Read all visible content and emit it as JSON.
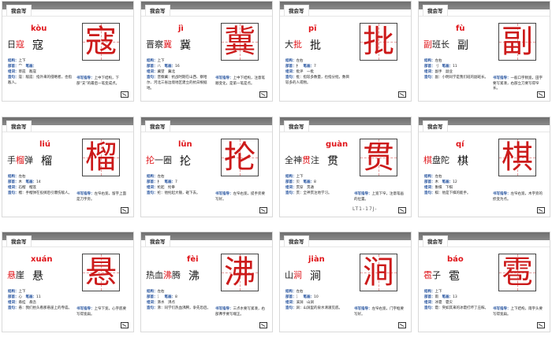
{
  "slides": [
    {
      "tab": "我会写",
      "pre": "日",
      "hl": "寇",
      "post": "",
      "pinyin": "kòu",
      "char": "寇",
      "structure": "上下",
      "radical": "宀",
      "strokes": "",
      "words": "草寇　敌寇",
      "note": "寇：敌寇：指外来的侵略者，也指敌人。",
      "guide": "上中下结构，下部“支”的最后一笔变成点。"
    },
    {
      "tab": "我会写",
      "pre": "晋察",
      "hl": "冀",
      "post": "",
      "pinyin": "jì",
      "char": "冀",
      "structure": "上下",
      "radical": "八",
      "strokes": "16",
      "words": "冀望　冀北",
      "note": "晋察冀：抗战时期在山西、察哈尔、河北三省边境地区建立的抗日根据地。",
      "guide": "上中下结构，注意笔顺变化，是第一笔是点。"
    },
    {
      "tab": "我会写",
      "pre": "大",
      "hl": "批",
      "post": "",
      "pinyin": "pī",
      "char": "批",
      "structure": "左右",
      "radical": "扌",
      "strokes": "7",
      "words": "批评　一批",
      "note": "批：指较多数量，也指分批，数目较多的人或物。",
      "guide": ""
    },
    {
      "tab": "我会写",
      "pre": "",
      "hl": "副",
      "post": "班长",
      "pinyin": "fù",
      "char": "副",
      "structure": "左右",
      "radical": "刂",
      "strokes": "11",
      "words": "副手　副业",
      "note": "副：小明同学是我们班的副班长。",
      "guide": "一般口字稍宽，田字要写紧凑，右部立刀要写得窄长。"
    },
    {
      "tab": "我会写",
      "pre": "手",
      "hl": "榴",
      "post": "弹",
      "pinyin": "liú",
      "char": "榴",
      "structure": "左右",
      "radical": "木",
      "strokes": "14",
      "words": "石榴　榴莲",
      "note": "榴：手榴弹在投掷后引爆伤敌人。",
      "guide": "左窄右宽，留字上面是刀字旁。"
    },
    {
      "tab": "我会写",
      "pre": "",
      "hl": "抡",
      "post": "一圈",
      "pinyin": "lūn",
      "char": "抡",
      "structure": "左右",
      "radical": "扌",
      "strokes": "7",
      "words": "抡起　抡拳",
      "note": "抡：他抡起大锤，砸下去。",
      "guide": "左窄右宽，提手旁要写好。"
    },
    {
      "tab": "我会写",
      "pre": "全神",
      "hl": "贯",
      "post": "注",
      "pinyin": "guàn",
      "char": "贯",
      "structure": "上下",
      "radical": "贝",
      "strokes": "8",
      "words": "贯穿　贯通",
      "note": "贯：全神贯注地学习。",
      "guide": "上宽下窄，注意笔画的位置。",
      "scribble": "LT1-17J-"
    },
    {
      "tab": "我会写",
      "pre": "",
      "hl": "棋",
      "post": "盘陀",
      "pinyin": "qí",
      "char": "棋",
      "structure": "左右",
      "radical": "木",
      "strokes": "12",
      "words": "象棋　下棋",
      "note": "棋：他是下棋的能手。",
      "guide": "左窄右宽，木字旁的捺变为点。"
    },
    {
      "tab": "我会写",
      "pre": "",
      "hl": "悬",
      "post": "崖",
      "pinyin": "xuán",
      "char": "悬",
      "structure": "上下",
      "radical": "心",
      "strokes": "11",
      "words": "悬挂　悬念",
      "note": "悬：我们抬头看那悬崖上的寺庙。",
      "guide": "上窄下宽，心字底要写得宽扁。"
    },
    {
      "tab": "我会写",
      "pre": "热血",
      "hl": "沸",
      "post": "腾",
      "pinyin": "fèi",
      "char": "沸",
      "structure": "左右",
      "radical": "氵",
      "strokes": "8",
      "words": "沸水　沸点",
      "note": "沸：同学们热血沸腾，争先恐后。",
      "guide": "三点水要写紧凑，右部弗字要写端正。"
    },
    {
      "tab": "我会写",
      "pre": "山",
      "hl": "涧",
      "post": "",
      "pinyin": "jiàn",
      "char": "涧",
      "structure": "左右",
      "radical": "氵",
      "strokes": "10",
      "words": "溪涧　山涧",
      "note": "涧：山涧里的泉水清澈见底。",
      "guide": "左窄右宽，门字框要写好。"
    },
    {
      "tab": "我会写",
      "pre": "",
      "hl": "雹",
      "post": "子",
      "pinyin": "báo",
      "char": "雹",
      "structure": "上下",
      "radical": "雨",
      "strokes": "13",
      "words": "冰雹　雹灾",
      "note": "雹：突如其来的冰雹打坏了庄稼。",
      "guide": "上下结构，雨字头要写得宽扁。"
    }
  ],
  "labels": {
    "structure": "结构：",
    "radical": "部首：",
    "strokes": "笔画：",
    "words": "组词：",
    "note": "造句：",
    "guide": "书写指导："
  }
}
